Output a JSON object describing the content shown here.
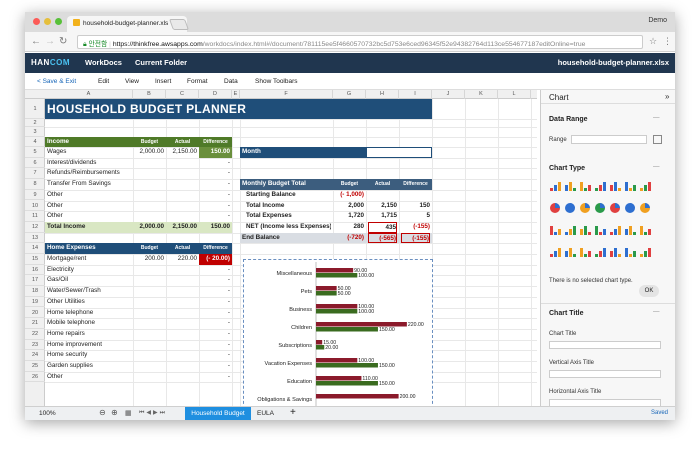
{
  "browser": {
    "tab_title": "household-budget-planner.xls",
    "profile": "Demo",
    "secure_label": "안전함",
    "url_domain": "https://thinkfree.awsapps.com",
    "url_path": "/workdocs/index.html#/document/781115ee5f4660570732bc5d753e6ced96345f52e94382764d113ce554677187editOnline=true"
  },
  "app": {
    "logo_prefix": "HAN",
    "logo_suffix": "COM",
    "menus": [
      "WorkDocs",
      "Current Folder"
    ],
    "doc_name": "household-budget-planner.xlsx"
  },
  "menubar": {
    "save": "< Save & Exit",
    "items": [
      "Edit",
      "View",
      "Insert",
      "Format",
      "Data",
      "Show Toolbars"
    ]
  },
  "columns": [
    "A",
    "B",
    "C",
    "D",
    "E",
    "F",
    "G",
    "H",
    "I",
    "J",
    "K",
    "L"
  ],
  "rows": [
    "1",
    "2",
    "3",
    "4",
    "5",
    "6",
    "7",
    "8",
    "9",
    "10",
    "11",
    "12",
    "13",
    "14",
    "15",
    "16",
    "17",
    "18",
    "19",
    "20",
    "21",
    "22",
    "23",
    "24",
    "25",
    "26"
  ],
  "title": "HOUSEHOLD BUDGET PLANNER",
  "income": {
    "header": "Income",
    "col_budget": "Budget",
    "col_actual": "Actual",
    "col_diff": "Difference",
    "rows": [
      {
        "label": "Wages",
        "budget": "2,000.00",
        "actual": "2,150.00",
        "diff": "150.00"
      },
      {
        "label": "Interest/dividends",
        "budget": "",
        "actual": "",
        "diff": "-"
      },
      {
        "label": "Refunds/Reimbursements",
        "budget": "",
        "actual": "",
        "diff": "-"
      },
      {
        "label": "Transfer From Savings",
        "budget": "",
        "actual": "",
        "diff": "-"
      },
      {
        "label": "Other",
        "budget": "",
        "actual": "",
        "diff": "-"
      },
      {
        "label": "Other",
        "budget": "",
        "actual": "",
        "diff": "-"
      },
      {
        "label": "Other",
        "budget": "",
        "actual": "",
        "diff": "-"
      }
    ],
    "total": {
      "label": "Total Income",
      "budget": "2,000.00",
      "actual": "2,150.00",
      "diff": "150.00"
    }
  },
  "home": {
    "header": "Home Expenses",
    "col_budget": "Budget",
    "col_actual": "Actual",
    "col_diff": "Difference",
    "rows": [
      {
        "label": "Mortgage/rent",
        "budget": "200.00",
        "actual": "220.00",
        "diff": "(- 20.00)"
      },
      {
        "label": "Electricity",
        "budget": "",
        "actual": "",
        "diff": "-"
      },
      {
        "label": "Gas/Oil",
        "budget": "",
        "actual": "",
        "diff": "-"
      },
      {
        "label": "Water/Sewer/Trash",
        "budget": "",
        "actual": "",
        "diff": "-"
      },
      {
        "label": "Other  Utilities",
        "budget": "",
        "actual": "",
        "diff": "-"
      },
      {
        "label": "Home  telephone",
        "budget": "",
        "actual": "",
        "diff": "-"
      },
      {
        "label": "Mobile  telephone",
        "budget": "",
        "actual": "",
        "diff": "-"
      },
      {
        "label": "Home  repairs",
        "budget": "",
        "actual": "",
        "diff": "-"
      },
      {
        "label": "Home  improvement",
        "budget": "",
        "actual": "",
        "diff": "-"
      },
      {
        "label": "Home  security",
        "budget": "",
        "actual": "",
        "diff": "-"
      },
      {
        "label": "Garden  supplies",
        "budget": "",
        "actual": "",
        "diff": "-"
      },
      {
        "label": "Other",
        "budget": "",
        "actual": "",
        "diff": "-"
      },
      {
        "label": "Other",
        "budget": "",
        "actual": "",
        "diff": "-"
      }
    ]
  },
  "month_label": "Month",
  "summary": {
    "header": "Monthly Budget Total",
    "col_budget": "Budget",
    "col_actual": "Actual",
    "col_diff": "Difference",
    "rows": [
      {
        "label": "Starting Balance",
        "budget": "(- 1,000)",
        "actual": "",
        "diff": ""
      },
      {
        "label": "Total Income",
        "budget": "2,000",
        "actual": "2,150",
        "diff": "150"
      },
      {
        "label": "Total Expenses",
        "budget": "1,720",
        "actual": "1,715",
        "diff": "5"
      },
      {
        "label": "NET  (Income  less  Expenses)",
        "budget": "280",
        "actual": "435",
        "diff": "(-155)"
      }
    ],
    "end": {
      "label": "End Balance",
      "budget": "(-720)",
      "actual": "(-565)",
      "diff": "(-155)"
    }
  },
  "colors": {
    "navy": "#1f4e79",
    "green": "#4f7a28",
    "totalrow": "#d9e7c3",
    "red": "#c00000",
    "bar_budget": "#8b1a2b",
    "bar_actual": "#3a6b1f"
  },
  "chart_data": {
    "type": "bar",
    "categories": [
      "Miscellaneous",
      "Pets",
      "Business",
      "Children",
      "Subscriptions",
      "Vacation Expenses",
      "Education",
      "Obligations & Savings"
    ],
    "series": [
      {
        "values": [
          90,
          50,
          100,
          220,
          15,
          100,
          110,
          200
        ]
      },
      {
        "values": [
          100,
          50,
          100,
          150,
          20,
          150,
          150,
          null
        ]
      }
    ],
    "xlim": [
      0,
      230
    ]
  },
  "sidebar": {
    "title": "Chart",
    "data_range": "Data Range",
    "range_label": "Range",
    "chart_type": "Chart Type",
    "no_chart": "There is no selected chart type.",
    "ok": "OK",
    "chart_title": "Chart Title",
    "fields": [
      "Chart Title",
      "Vertical Axis Title",
      "Horizontal Axis Title"
    ]
  },
  "bottom": {
    "zoom": "100%",
    "sheets": [
      "Household Budget",
      "EULA"
    ],
    "add": "+",
    "status": "Saved"
  }
}
